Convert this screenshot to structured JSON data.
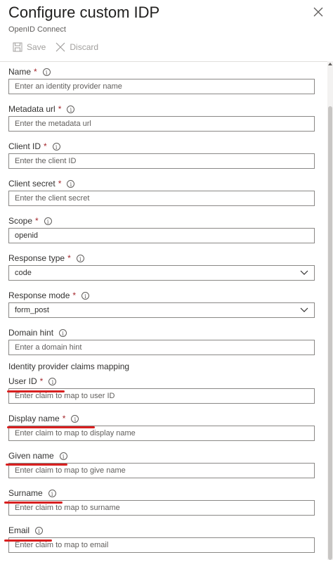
{
  "header": {
    "title": "Configure custom IDP",
    "subtitle": "OpenID Connect"
  },
  "toolbar": {
    "save_label": "Save",
    "discard_label": "Discard"
  },
  "fields": [
    {
      "label": "Name",
      "required": true,
      "placeholder": "Enter an identity provider name",
      "value": ""
    },
    {
      "label": "Metadata url",
      "required": true,
      "placeholder": "Enter the metadata url",
      "value": ""
    },
    {
      "label": "Client ID",
      "required": true,
      "placeholder": "Enter the client ID",
      "value": ""
    },
    {
      "label": "Client secret",
      "required": true,
      "placeholder": "Enter the client secret",
      "value": ""
    },
    {
      "label": "Scope",
      "required": true,
      "placeholder": "",
      "value": "openid"
    },
    {
      "label": "Response type",
      "required": true,
      "value": "code"
    },
    {
      "label": "Response mode",
      "required": true,
      "value": "form_post"
    },
    {
      "label": "Domain hint",
      "required": false,
      "placeholder": "Enter a domain hint",
      "value": ""
    }
  ],
  "claims_section": {
    "title": "Identity provider claims mapping",
    "fields": [
      {
        "label": "User ID",
        "required": true,
        "placeholder": "Enter claim to map to user ID"
      },
      {
        "label": "Display name",
        "required": true,
        "placeholder": "Enter claim to map to display name"
      },
      {
        "label": "Given name",
        "required": false,
        "placeholder": "Enter claim to map to give name"
      },
      {
        "label": "Surname",
        "required": false,
        "placeholder": "Enter claim to map to surname"
      },
      {
        "label": "Email",
        "required": false,
        "placeholder": "Enter claim to map to email"
      }
    ]
  },
  "required_marker": "*",
  "info_glyph": "i",
  "colors": {
    "required": "#a4262c",
    "annotation": "#d81f1f",
    "border": "#8a8886"
  }
}
